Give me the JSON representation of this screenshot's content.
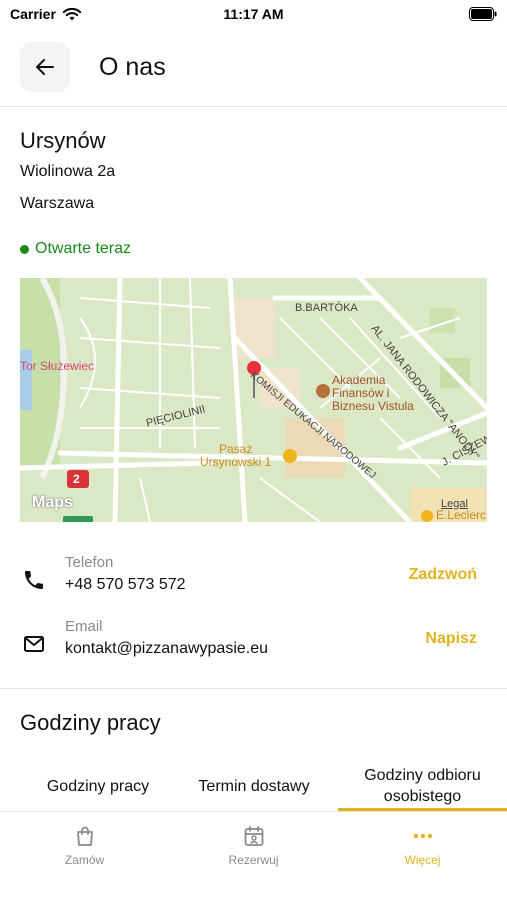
{
  "status_bar": {
    "carrier": "Carrier",
    "time": "11:17 AM"
  },
  "header": {
    "title": "O nas",
    "back_icon": "arrow-left-icon"
  },
  "location": {
    "name": "Ursynów",
    "street": "Wiolinowa 2a",
    "city": "Warszawa",
    "status": "Otwarte teraz",
    "status_color": "#1a8a1a"
  },
  "map": {
    "labels": {
      "bartoka": "B.BARTÓKA",
      "rodowicza": "AL. JANA RODOWICZA \"ANODY\"",
      "tor": "Tor Służewiec",
      "akademia": "Akademia\nFinansów i\nBiznesu Vistula",
      "pieciolinii": "PIĘCIOLINII",
      "komisji": "KOMISJI EDUKACJI NARODOWEJ",
      "pasaz": "Pasaż\nUrsynowski 1",
      "ciszewskiego": "J. CISZEWS",
      "route": "2",
      "maps": "Maps",
      "legal": "Legal",
      "leclerc": "E.Leclerc"
    }
  },
  "contacts": [
    {
      "label": "Telefon",
      "value": "+48 570 573 572",
      "action": "Zadzwoń",
      "icon": "phone-icon"
    },
    {
      "label": "Email",
      "value": "kontakt@pizzanawypasie.eu",
      "action": "Napisz",
      "icon": "mail-icon"
    }
  ],
  "hours": {
    "title": "Godziny pracy",
    "tabs": [
      "Godziny pracy",
      "Termin dostawy",
      "Godziny odbioru osobistego"
    ],
    "active_tab": 2
  },
  "bottom_nav": [
    {
      "label": "Zamów",
      "icon": "bag-icon"
    },
    {
      "label": "Rezerwuj",
      "icon": "calendar-icon"
    },
    {
      "label": "Więcej",
      "icon": "more-dots-icon"
    }
  ],
  "colors": {
    "accent": "#e3b21f",
    "open": "#1a8a1a",
    "muted": "#8a8a8a"
  }
}
